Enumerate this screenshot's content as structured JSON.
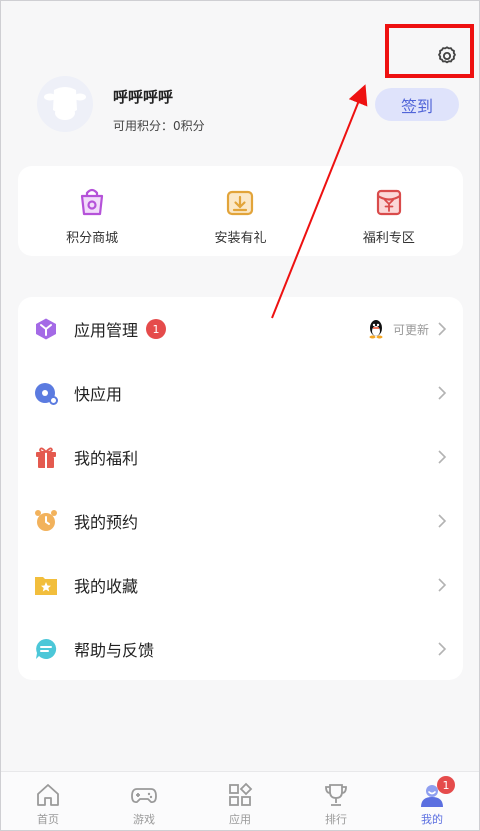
{
  "profile": {
    "username": "呼呼呼呼",
    "points_text": "可用积分：0积分",
    "signin_label": "签到"
  },
  "quick_links": [
    {
      "label": "积分商城",
      "icon": "shopping-bag-icon"
    },
    {
      "label": "安装有礼",
      "icon": "install-gift-icon"
    },
    {
      "label": "福利专区",
      "icon": "welfare-envelope-icon"
    }
  ],
  "menu": [
    {
      "label": "应用管理",
      "icon": "app-manage-cube-icon",
      "badge": "1",
      "extra": "可更新"
    },
    {
      "label": "快应用",
      "icon": "quick-app-icon"
    },
    {
      "label": "我的福利",
      "icon": "gift-icon"
    },
    {
      "label": "我的预约",
      "icon": "alarm-clock-icon"
    },
    {
      "label": "我的收藏",
      "icon": "star-folder-icon"
    },
    {
      "label": "帮助与反馈",
      "icon": "chat-bubble-icon"
    }
  ],
  "nav": [
    {
      "label": "首页",
      "icon": "home-icon"
    },
    {
      "label": "游戏",
      "icon": "gamepad-icon"
    },
    {
      "label": "应用",
      "icon": "apps-grid-icon"
    },
    {
      "label": "排行",
      "icon": "trophy-icon"
    },
    {
      "label": "我的",
      "icon": "user-icon",
      "badge": "1",
      "active": true
    }
  ],
  "colors": {
    "accent": "#5b6fe0",
    "highlight": "#ee1111",
    "badge": "#e54b4b"
  }
}
